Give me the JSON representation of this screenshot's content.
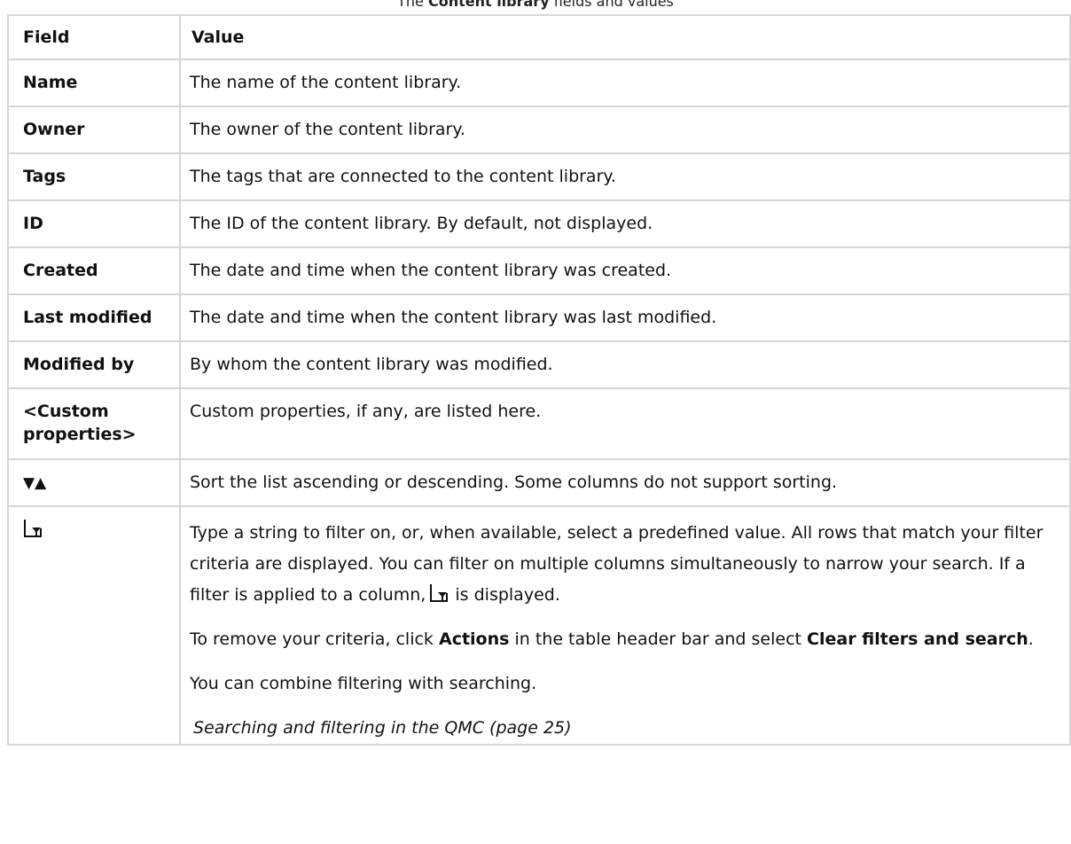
{
  "caption": {
    "prefix": "The ",
    "bold": "Content library",
    "suffix": " fields and values"
  },
  "table": {
    "headers": {
      "field": "Field",
      "value": "Value"
    },
    "rows": [
      {
        "field": "Name",
        "value": "The name of the content library."
      },
      {
        "field": "Owner",
        "value": "The owner of the content library."
      },
      {
        "field": "Tags",
        "value": "The tags that are connected to the content library."
      },
      {
        "field": "ID",
        "value": "The ID of the content library. By default, not displayed."
      },
      {
        "field": "Created",
        "value": "The date and time when the content library was created."
      },
      {
        "field": "Last modified",
        "value": "The date and time when the content library was last modified."
      },
      {
        "field": "Modified by",
        "value": "By whom the content library was modified."
      },
      {
        "field": "<Custom properties>",
        "value": "Custom properties, if any, are listed here."
      }
    ],
    "sort_row": {
      "icons": "▼▲",
      "value": "Sort the list ascending or descending. Some columns do not support sorting."
    },
    "filter_row": {
      "icon_name": "filter-icon",
      "para1_text": "Type a string to filter on, or, when available, select a predefined value. All rows that match your filter criteria are displayed. You can filter on multiple columns simultaneously to narrow your search. If a filter is applied to a column,",
      "para1_suffix": " is displayed.",
      "para2_prefix": "To remove your criteria, click ",
      "para2_bold1": "Actions",
      "para2_middle": " in the table header bar and select ",
      "para2_bold2": "Clear filters and search",
      "para2_suffix": ".",
      "para3": "You can combine filtering with searching.",
      "link": "Searching and filtering in the QMC (page 25)"
    }
  }
}
